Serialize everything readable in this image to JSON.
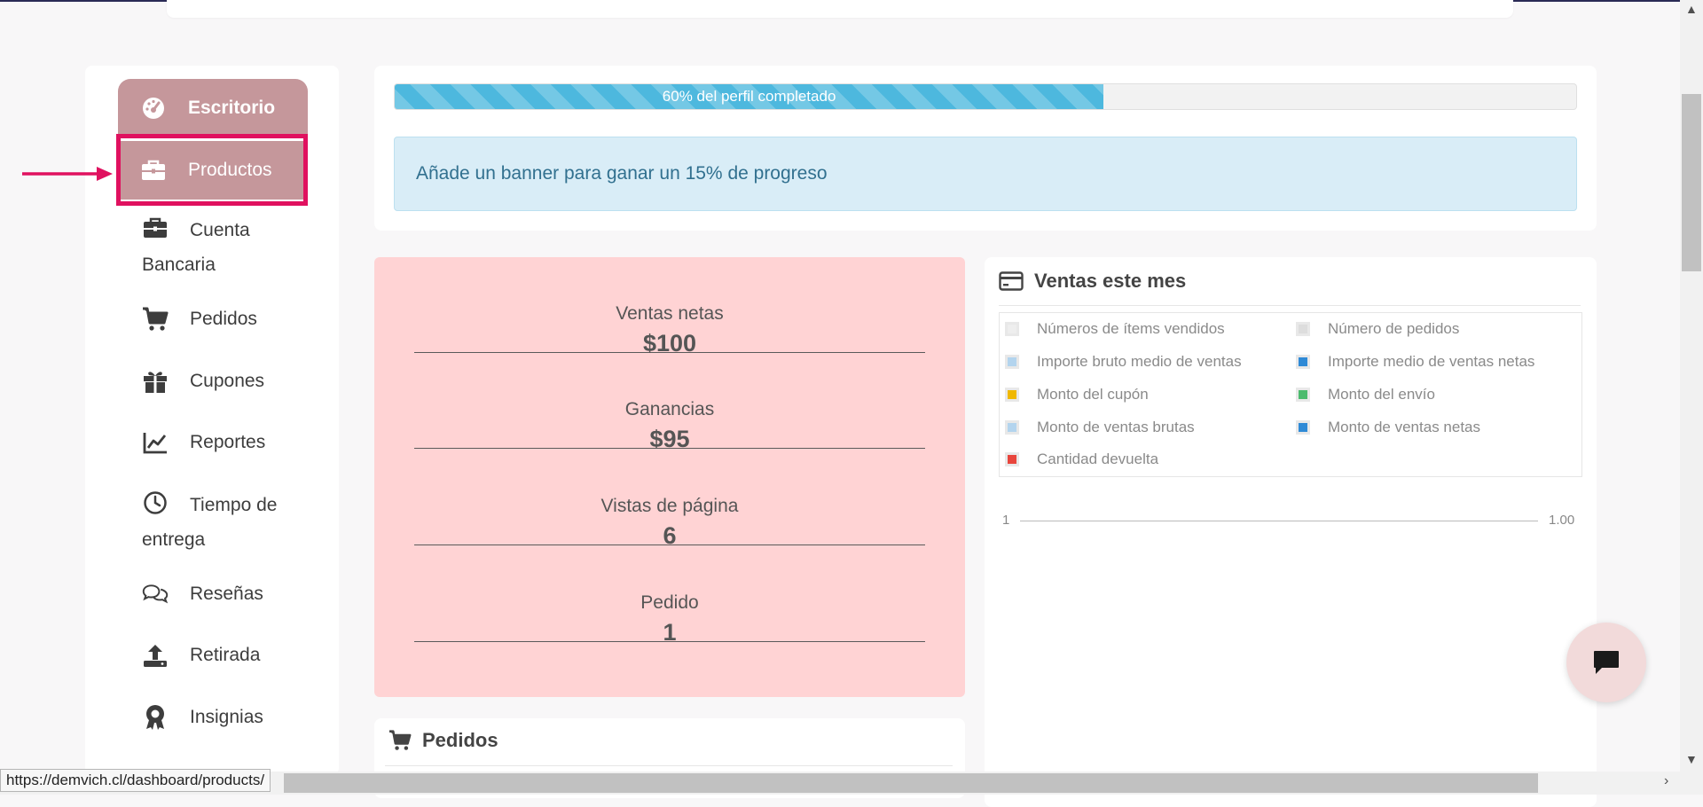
{
  "sidebar": {
    "items": [
      {
        "label": "Escritorio",
        "icon": "dashboard-gauge-icon"
      },
      {
        "label": "Productos",
        "icon": "briefcase-icon"
      },
      {
        "label": "Cuenta",
        "label2": "Bancaria",
        "icon": "briefcase-icon"
      },
      {
        "label": "Pedidos",
        "icon": "cart-icon"
      },
      {
        "label": "Cupones",
        "icon": "gift-icon"
      },
      {
        "label": "Reportes",
        "icon": "line-chart-icon"
      },
      {
        "label": "Tiempo de",
        "label2": "entrega",
        "icon": "clock-icon"
      },
      {
        "label": "Reseñas",
        "icon": "comments-icon"
      },
      {
        "label": "Retirada",
        "icon": "upload-icon"
      },
      {
        "label": "Insignias",
        "icon": "award-icon"
      }
    ]
  },
  "progress": {
    "percent": 60,
    "label": "60% del perfil completado",
    "hint": "Añade un banner para ganar un 15% de progreso"
  },
  "stats": [
    {
      "label": "Ventas netas",
      "value": "$100"
    },
    {
      "label": "Ganancias",
      "value": "$95"
    },
    {
      "label": "Vistas de página",
      "value": "6"
    },
    {
      "label": "Pedido",
      "value": "1"
    }
  ],
  "sales": {
    "title": "Ventas este mes",
    "legend": [
      {
        "label": "Números de ítems vendidos",
        "color": "#eeeeee"
      },
      {
        "label": "Número de pedidos",
        "color": "#dddddd"
      },
      {
        "label": "Importe bruto medio de ventas",
        "color": "#b3d4ee"
      },
      {
        "label": "Importe medio de ventas netas",
        "color": "#2f8ad6"
      },
      {
        "label": "Monto del cupón",
        "color": "#f0b800"
      },
      {
        "label": "Monto del envío",
        "color": "#4cbb6e"
      },
      {
        "label": "Monto de ventas brutas",
        "color": "#b3d4ee"
      },
      {
        "label": "Monto de ventas netas",
        "color": "#2f8ad6"
      },
      {
        "label": "Cantidad devuelta",
        "color": "#e8453c"
      }
    ],
    "axis_left": "1",
    "axis_right": "1.00"
  },
  "orders": {
    "title": "Pedidos"
  },
  "status_bar": {
    "url": "https://demvich.cl/dashboard/products/"
  },
  "colors": {
    "sidebar_active": "#c5979b",
    "highlight": "#e0115f",
    "stats_bg": "#ffd3d4",
    "progress": "#4db8de"
  }
}
